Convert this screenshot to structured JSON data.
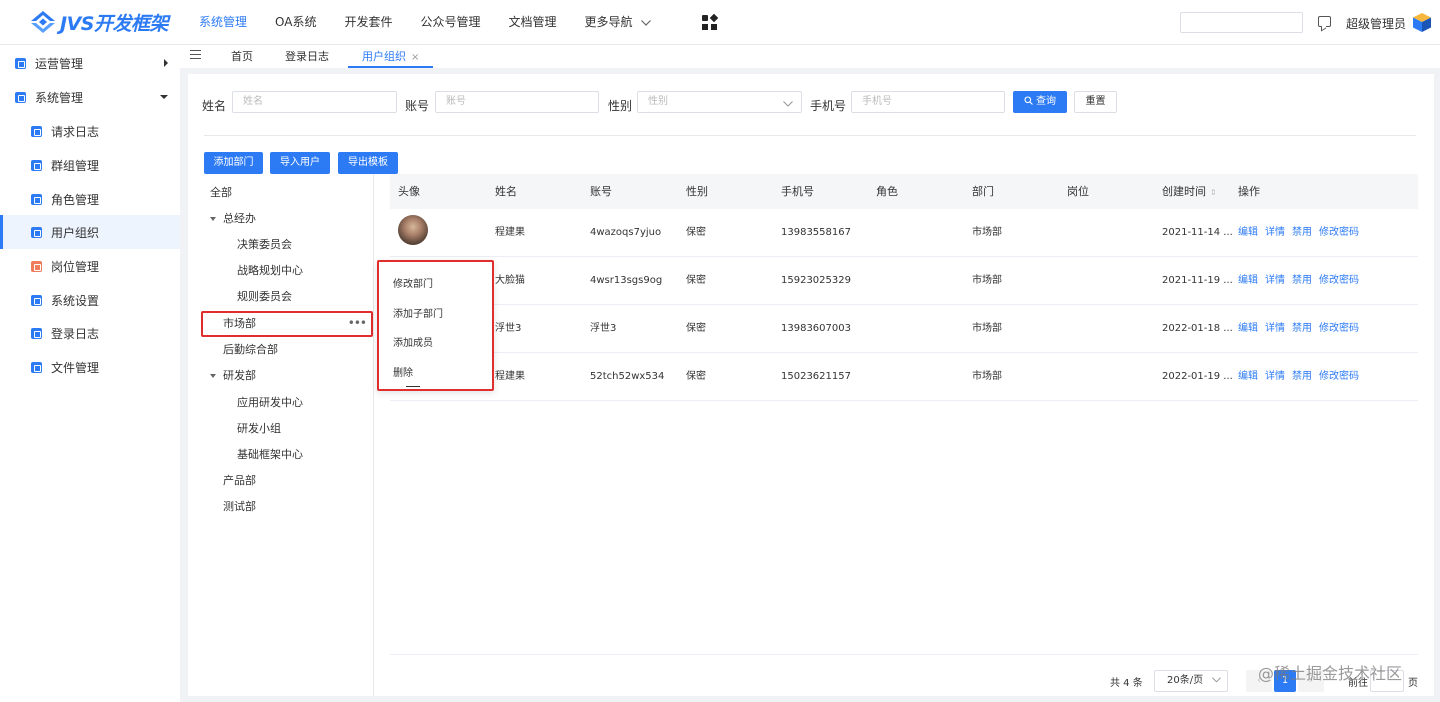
{
  "app": {
    "logo_text": "JVS开发框架",
    "brand_color": "#2d7bf4"
  },
  "topnav": {
    "items": [
      "系统管理",
      "OA系统",
      "开发套件",
      "公众号管理",
      "文档管理",
      "更多导航"
    ],
    "user_name": "超级管理员"
  },
  "sidebar": {
    "items": [
      {
        "label": "运营管理",
        "icon": "ops-icon"
      },
      {
        "label": "系统管理",
        "icon": "system-icon"
      },
      {
        "label": "请求日志",
        "icon": "request-log-icon"
      },
      {
        "label": "群组管理",
        "icon": "group-icon"
      },
      {
        "label": "角色管理",
        "icon": "role-icon"
      },
      {
        "label": "用户组织",
        "icon": "user-org-icon"
      },
      {
        "label": "岗位管理",
        "icon": "position-icon"
      },
      {
        "label": "系统设置",
        "icon": "settings-icon"
      },
      {
        "label": "登录日志",
        "icon": "login-log-icon"
      },
      {
        "label": "文件管理",
        "icon": "file-icon"
      }
    ]
  },
  "tabs": {
    "home": "首页",
    "login_log": "登录日志",
    "user_org": "用户组织",
    "close": "×"
  },
  "filters": {
    "name_label": "姓名",
    "name_placeholder": "姓名",
    "account_label": "账号",
    "account_placeholder": "账号",
    "gender_label": "性别",
    "gender_placeholder": "性别",
    "phone_label": "手机号",
    "phone_placeholder": "手机号",
    "search_button": "查询",
    "reset_button": "重置"
  },
  "actions": {
    "add_dept": "添加部门",
    "import_users": "导入用户",
    "export_template": "导出模板"
  },
  "tree": {
    "all": "全部",
    "n1": "总经办",
    "n1a": "决策委员会",
    "n1b": "战略规划中心",
    "n1c": "规则委员会",
    "n2": "市场部",
    "n2_more": "•••",
    "n3": "后勤综合部",
    "n4": "研发部",
    "n4a": "应用研发中心",
    "n4b": "研发小组",
    "n4c": "基础框架中心",
    "n5": "产品部",
    "n6": "测试部"
  },
  "table": {
    "headers": {
      "avatar": "头像",
      "name": "姓名",
      "account": "账号",
      "gender": "性别",
      "phone": "手机号",
      "role": "角色",
      "dept": "部门",
      "post": "岗位",
      "created": "创建时间",
      "sort": "⇕",
      "ops": "操作"
    },
    "ops": {
      "edit": "编辑",
      "detail": "详情",
      "disable": "禁用",
      "change_pwd": "修改密码"
    },
    "rows": [
      {
        "name": "程建果",
        "account": "4wazoqs7yjuo",
        "gender": "保密",
        "phone": "13983558167",
        "dept": "市场部",
        "created": "2021-11-14 ..."
      },
      {
        "name": "大脸猫",
        "account": "4wsr13sgs9og",
        "gender": "保密",
        "phone": "15923025329",
        "dept": "市场部",
        "created": "2021-11-19 ..."
      },
      {
        "name": "浮世3",
        "account": "浮世3",
        "gender": "保密",
        "phone": "13983607003",
        "dept": "市场部",
        "created": "2022-01-18 ..."
      },
      {
        "name": "程建果",
        "account": "52tch52wx534",
        "gender": "保密",
        "phone": "15023621157",
        "dept": "市场部",
        "created": "2022-01-19 ..."
      }
    ]
  },
  "context_menu": {
    "edit_dept": "修改部门",
    "add_sub_dept": "添加子部门",
    "add_member": "添加成员",
    "delete": "删除"
  },
  "pagination": {
    "total": "共 4 条",
    "page_size": "20条/页",
    "prev": "‹",
    "current_page": "1",
    "next": "›",
    "goto": "前往",
    "page_suffix": "页"
  },
  "watermark": "@稀土掘金技术社区"
}
